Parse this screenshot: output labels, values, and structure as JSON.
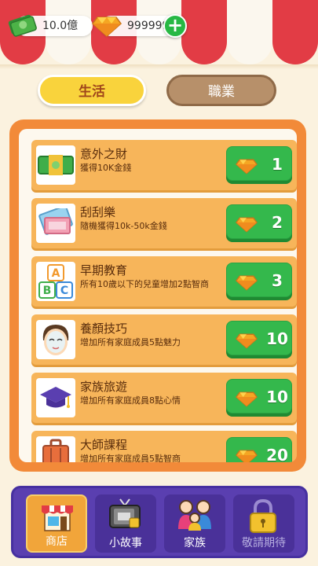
{
  "currency": {
    "money": "10.0億",
    "gems": "9999999"
  },
  "tabs": [
    {
      "label": "生活",
      "active": true
    },
    {
      "label": "職業",
      "active": false
    }
  ],
  "items": [
    {
      "title": "意外之財",
      "desc": "獲得10K金錢",
      "price": "1",
      "icon": "money-stack-icon"
    },
    {
      "title": "刮刮樂",
      "desc": "隨機獲得10k-50k金錢",
      "price": "2",
      "icon": "scratch-ticket-icon"
    },
    {
      "title": "早期教育",
      "desc": "所有10歲以下的兒童增加2點智商",
      "price": "3",
      "icon": "abc-blocks-icon"
    },
    {
      "title": "養顏技巧",
      "desc": "增加所有家庭成員5點魅力",
      "price": "10",
      "icon": "face-mask-icon"
    },
    {
      "title": "家族旅遊",
      "desc": "增加所有家庭成員8點心情",
      "price": "10",
      "icon": "graduation-cap-icon"
    },
    {
      "title": "大師課程",
      "desc": "增加所有家庭成員5點智商",
      "price": "20",
      "icon": "suitcase-icon"
    }
  ],
  "nav": [
    {
      "label": "商店",
      "icon": "shop-icon",
      "active": true
    },
    {
      "label": "小故事",
      "icon": "tv-icon",
      "active": false
    },
    {
      "label": "家族",
      "icon": "family-icon",
      "active": false
    },
    {
      "label": "敬請期待",
      "icon": "lock-icon",
      "active": false
    }
  ],
  "colors": {
    "awning_red": "#e23c45",
    "panel_orange": "#f28a39",
    "buy_green": "#34b84c",
    "nav_purple": "#5a3fb0"
  }
}
